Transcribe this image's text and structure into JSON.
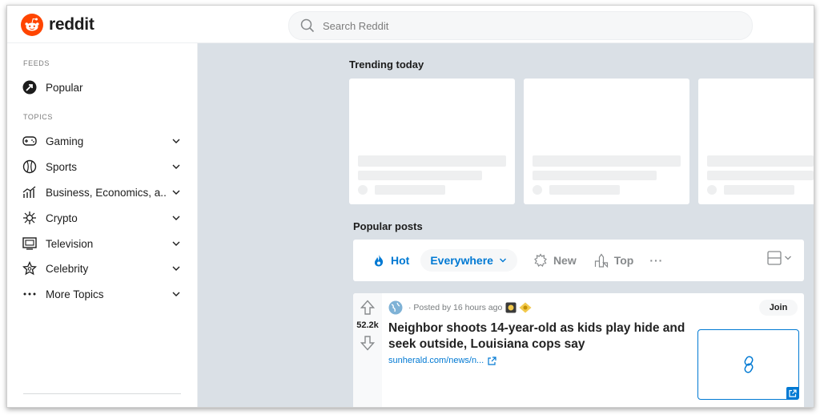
{
  "header": {
    "logo_text": "reddit",
    "search_placeholder": "Search Reddit"
  },
  "sidebar": {
    "feeds_title": "FEEDS",
    "popular_label": "Popular",
    "topics_title": "TOPICS",
    "topics": [
      {
        "label": "Gaming",
        "icon": "gamepad-icon"
      },
      {
        "label": "Sports",
        "icon": "ball-icon"
      },
      {
        "label": "Business, Economics, a...",
        "icon": "chart-icon"
      },
      {
        "label": "Crypto",
        "icon": "crypto-icon"
      },
      {
        "label": "Television",
        "icon": "tv-icon"
      },
      {
        "label": "Celebrity",
        "icon": "star-icon"
      },
      {
        "label": "More Topics",
        "icon": "more-icon"
      }
    ]
  },
  "main": {
    "trending_title": "Trending today",
    "popular_title": "Popular posts",
    "sort": {
      "hot": "Hot",
      "everywhere": "Everywhere",
      "new": "New",
      "top": "Top",
      "more": "···"
    },
    "post": {
      "votes": "52.2k",
      "meta": "· Posted by 16 hours ago",
      "title": "Neighbor shoots 14-year-old as kids play hide and seek outside, Louisiana cops say",
      "link": "sunherald.com/news/n...",
      "join": "Join"
    }
  },
  "colors": {
    "brand": "#ff4500",
    "accent": "#0079d3",
    "main_bg": "#dae0e6"
  }
}
